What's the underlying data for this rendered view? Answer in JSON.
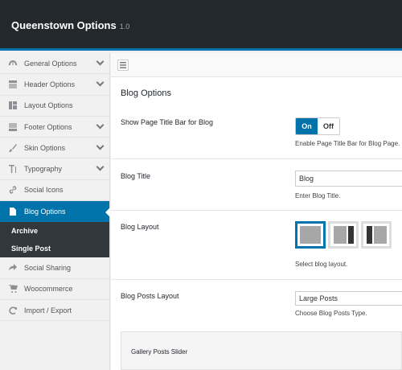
{
  "header": {
    "title": "Queenstown Options",
    "version": "1.0"
  },
  "sidebar": {
    "items_top": [
      {
        "label": "General Options",
        "icon": "gauge-icon",
        "chevron": true
      },
      {
        "label": "Header Options",
        "icon": "header-icon",
        "chevron": true
      },
      {
        "label": "Layout Options",
        "icon": "layout-icon",
        "chevron": false
      },
      {
        "label": "Footer Options",
        "icon": "footer-icon",
        "chevron": true
      },
      {
        "label": "Skin Options",
        "icon": "brush-icon",
        "chevron": true
      },
      {
        "label": "Typography",
        "icon": "typography-icon",
        "chevron": true
      },
      {
        "label": "Social Icons",
        "icon": "link-icon",
        "chevron": false
      }
    ],
    "active": {
      "label": "Blog Options",
      "icon": "document-icon"
    },
    "subitems": [
      "Archive",
      "Single Post"
    ],
    "items_bottom": [
      {
        "label": "Social Sharing",
        "icon": "share-icon"
      },
      {
        "label": "Woocommerce",
        "icon": "cart-icon"
      },
      {
        "label": "Import / Export",
        "icon": "refresh-icon"
      }
    ]
  },
  "main": {
    "section_title": "Blog Options",
    "title_bar": {
      "label": "Show Page Title Bar for Blog",
      "on_label": "On",
      "off_label": "Off",
      "description": "Enable Page Title Bar for Blog Page."
    },
    "blog_title": {
      "label": "Blog Title",
      "value": "Blog",
      "description": "Enter Blog Title."
    },
    "blog_layout": {
      "label": "Blog Layout",
      "description": "Select blog layout.",
      "selected_index": 0
    },
    "posts_layout": {
      "label": "Blog Posts Layout",
      "value": "Large Posts",
      "description": "Choose Blog Posts Type."
    },
    "gallery": {
      "label": "Gallery Posts Slider"
    }
  },
  "colors": {
    "accent": "#0073aa",
    "header_bg": "#23282d",
    "sub_bg": "#32373c"
  }
}
